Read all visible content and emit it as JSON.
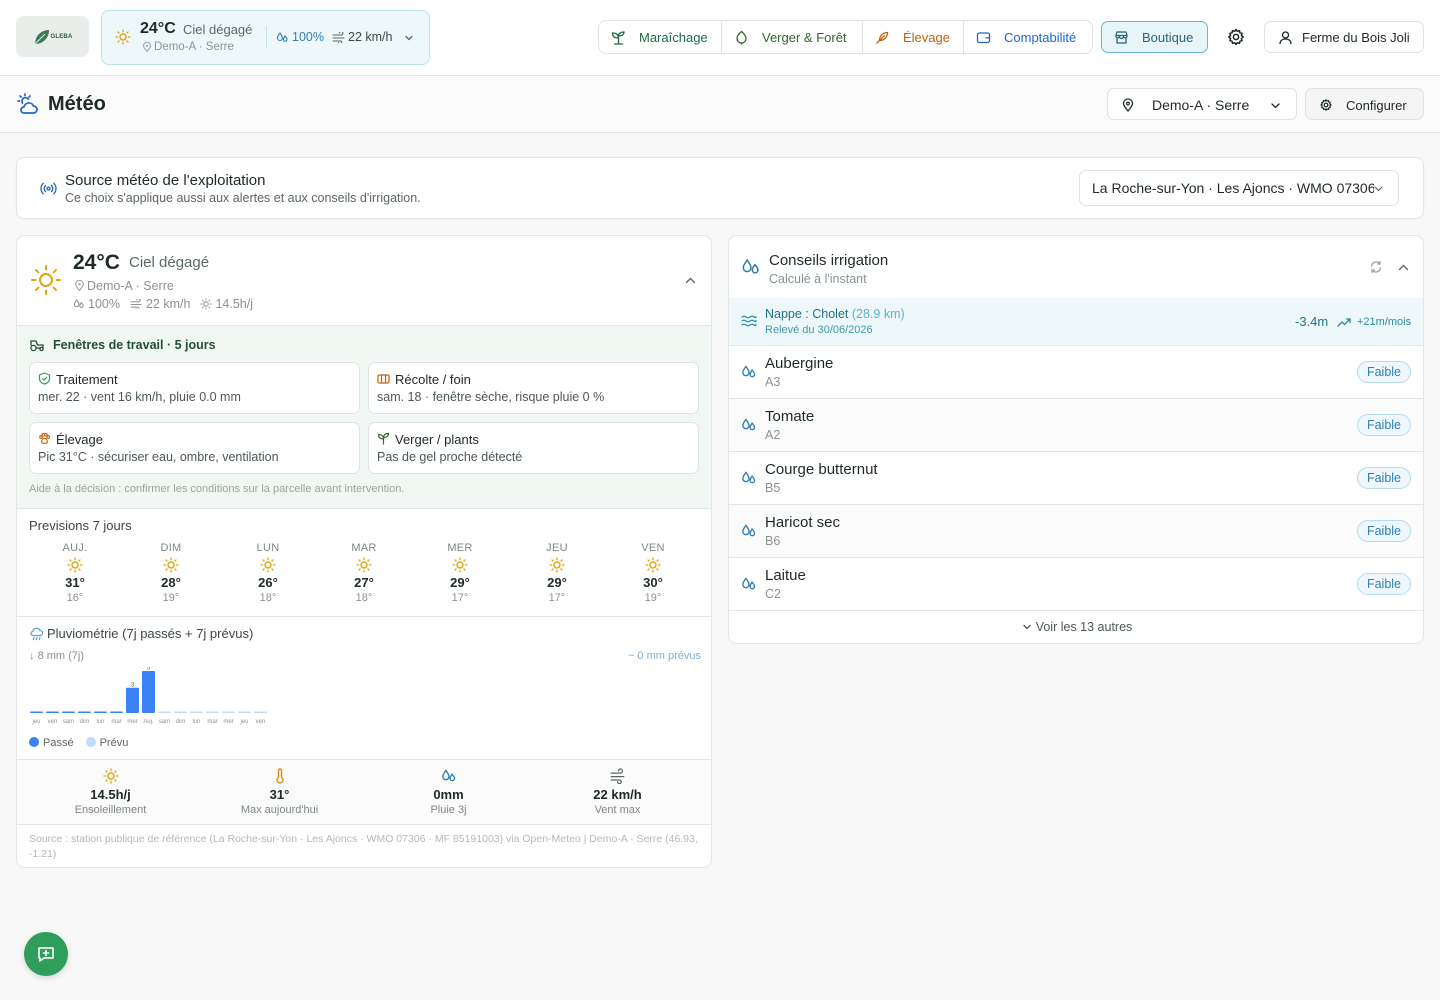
{
  "topbar": {
    "logo": "GLEBA",
    "weather": {
      "temp": "24°C",
      "condition": "Ciel dégagé",
      "location": "Demo-A · Serre",
      "humidity": "100%",
      "wind": "22 km/h"
    },
    "modules": [
      {
        "label": "Maraîchage",
        "color": "#1d6b48"
      },
      {
        "label": "Verger & Forêt",
        "color": "#2e6a2a"
      },
      {
        "label": "Élevage",
        "color": "#c2610c"
      },
      {
        "label": "Comptabilité",
        "color": "#1f67c9"
      }
    ],
    "boutique": "Boutique",
    "farm": "Ferme du Bois Joli"
  },
  "page": {
    "title": "Météo",
    "location_select": "Demo-A · Serre",
    "configure": "Configurer"
  },
  "source": {
    "title": "Source météo de l'exploitation",
    "subtitle": "Ce choix s'applique aussi aux alertes et aux conseils d'irrigation.",
    "selected": "La Roche-sur-Yon · Les Ajoncs · WMO 07306"
  },
  "weather": {
    "temp": "24°C",
    "condition": "Ciel dégagé",
    "location": "Demo-A · Serre",
    "humidity": "100%",
    "wind": "22 km/h",
    "sun": "14.5h/j",
    "work": {
      "title": "Fenêtres de travail · 5 jours",
      "items": [
        {
          "title": "Traitement",
          "detail": "mer. 22 · vent 16 km/h, pluie 0.0 mm"
        },
        {
          "title": "Récolte / foin",
          "detail": "sam. 18 · fenêtre sèche, risque pluie 0 %"
        },
        {
          "title": "Élevage",
          "detail": "Pic 31°C · sécuriser eau, ombre, ventilation"
        },
        {
          "title": "Verger / plants",
          "detail": "Pas de gel proche détecté"
        }
      ],
      "note": "Aide à la décision : confirmer les conditions sur la parcelle avant intervention."
    },
    "forecast_title": "Previsions 7 jours",
    "forecast": [
      {
        "day": "AUJ.",
        "hi": "31°",
        "lo": "16°"
      },
      {
        "day": "DIM",
        "hi": "28°",
        "lo": "19°"
      },
      {
        "day": "LUN",
        "hi": "26°",
        "lo": "18°"
      },
      {
        "day": "MAR",
        "hi": "27°",
        "lo": "18°"
      },
      {
        "day": "MER",
        "hi": "29°",
        "lo": "17°"
      },
      {
        "day": "JEU",
        "hi": "29°",
        "lo": "17°"
      },
      {
        "day": "VEN",
        "hi": "30°",
        "lo": "19°"
      }
    ],
    "rain": {
      "title": "Pluviométrie (7j passés + 7j prévus)",
      "past_total": "8 mm (7j)",
      "forecast_total": "0 mm prévus",
      "legend_past": "Passé",
      "legend_forecast": "Prévu",
      "past_color": "#3b82f6",
      "forecast_color": "#bfdbfe"
    },
    "stats": [
      {
        "value": "14.5h/j",
        "label": "Ensoleillement"
      },
      {
        "value": "31°",
        "label": "Max aujourd'hui"
      },
      {
        "value": "0mm",
        "label": "Pluie 3j"
      },
      {
        "value": "22 km/h",
        "label": "Vent max"
      }
    ],
    "source_note": "Source : station publique de référence (La Roche-sur-Yon · Les Ajoncs · WMO 07306 · MF 85191003) via Open-Meteo | Demo-A · Serre (46.93, -1.21)"
  },
  "chart_data": {
    "type": "bar",
    "title": "Pluviométrie (7j passés + 7j prévus)",
    "categories": [
      "jeu",
      "ven",
      "sam",
      "dim",
      "lun",
      "mar",
      "mer",
      "Auj.",
      "sam",
      "dim",
      "lun",
      "mar",
      "mer",
      "jeu",
      "ven"
    ],
    "series": [
      {
        "name": "Passé",
        "values": [
          0,
          0,
          0,
          0,
          0,
          0,
          3,
          5,
          null,
          null,
          null,
          null,
          null,
          null,
          null
        ]
      },
      {
        "name": "Prévu",
        "values": [
          null,
          null,
          null,
          null,
          null,
          null,
          null,
          null,
          0,
          0,
          0,
          0,
          0,
          0,
          0
        ]
      }
    ],
    "data_labels": {
      "6": "3",
      "7": "5"
    },
    "ylim": [
      0,
      5
    ]
  },
  "irrigation": {
    "title": "Conseils irrigation",
    "subtitle": "Calculé à l'instant",
    "nappe": {
      "label": "Nappe : Cholet",
      "distance": "(28.9 km)",
      "reading": "Relevé du 30/06/2026",
      "level": "-3.4m",
      "trend": "+21m/mois"
    },
    "crops": [
      {
        "name": "Aubergine",
        "plot": "A3",
        "level": "Faible"
      },
      {
        "name": "Tomate",
        "plot": "A2",
        "level": "Faible"
      },
      {
        "name": "Courge butternut",
        "plot": "B5",
        "level": "Faible"
      },
      {
        "name": "Haricot sec",
        "plot": "B6",
        "level": "Faible"
      },
      {
        "name": "Laitue",
        "plot": "C2",
        "level": "Faible"
      }
    ],
    "more": "Voir les 13 autres"
  }
}
